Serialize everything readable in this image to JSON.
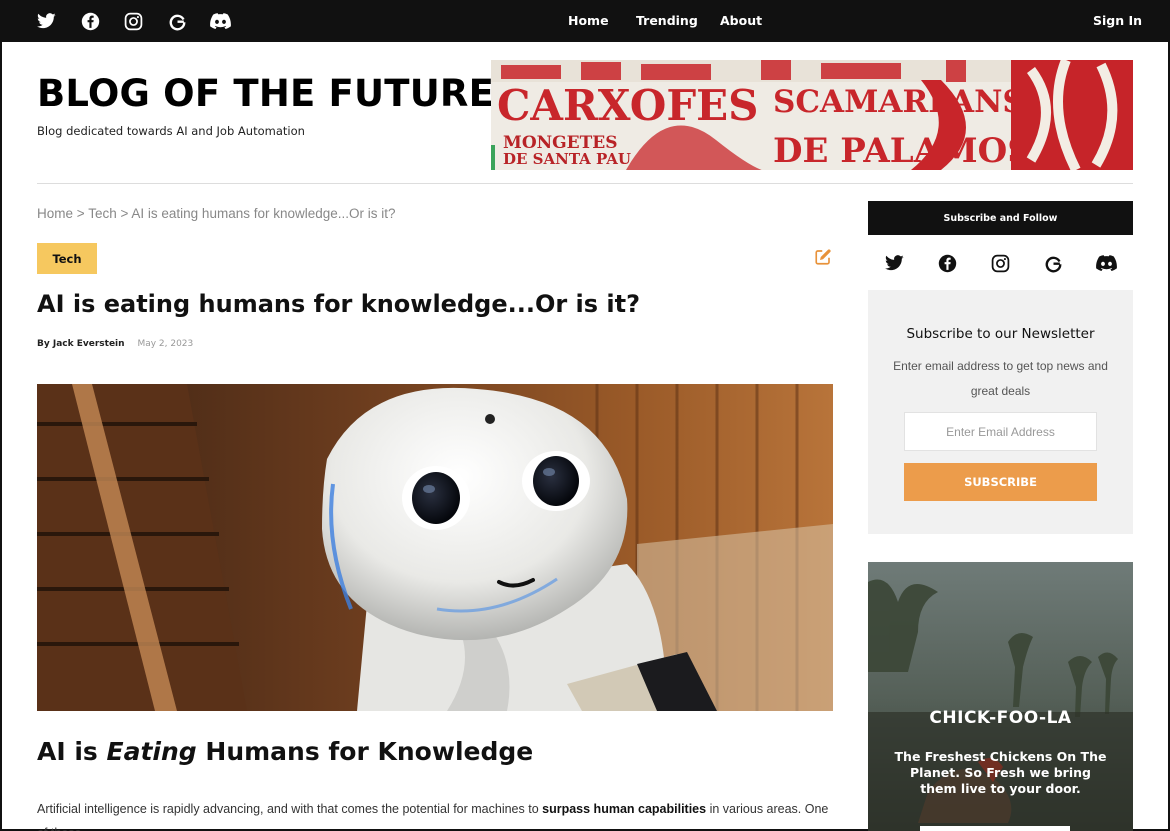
{
  "nav": {
    "social": [
      "twitter-icon",
      "facebook-icon",
      "instagram-icon",
      "google-icon",
      "discord-icon"
    ],
    "links": [
      "Home",
      "Trending",
      "About"
    ],
    "sign_in": "Sign In"
  },
  "brand": {
    "title": "BLOG OF THE FUTURE",
    "tagline": "Blog dedicated towards AI and Job Automation",
    "banner_text": [
      "CARXOFES",
      "SCAMARLANS",
      "MONGETES",
      "DE SANTA PAU",
      "DE PALAMOS"
    ]
  },
  "breadcrumb": {
    "home": "Home",
    "sep": ">",
    "category": "Tech",
    "current": "AI is eating humans for knowledge...Or is it?"
  },
  "article": {
    "tag": "Tech",
    "title": "AI is eating humans for knowledge...Or is it?",
    "author": "By Jack Everstein",
    "date": "May 2, 2023",
    "h2_pre": "AI is ",
    "h2_em": "Eating",
    "h2_post": " Humans for Knowledge",
    "para_pre": "Artificial intelligence is rapidly advancing, and with that comes the potential for machines to ",
    "para_bold": "surpass human capabilities",
    "para_post": " in various areas. One of these"
  },
  "sidebar": {
    "follow_header": "Subscribe and Follow",
    "newsletter_title": "Subscribe to our Newsletter",
    "newsletter_desc": "Enter email address to get top news and great deals",
    "email_placeholder": "Enter Email Address",
    "subscribe_label": "SUBSCRIBE"
  },
  "ad": {
    "title": "CHICK-FOO-LA",
    "text": "The Freshest Chickens On The Planet. So Fresh we bring them live to your door."
  },
  "colors": {
    "accent": "#ec9c4b",
    "tag": "#f6c85f",
    "dark": "#111111"
  }
}
